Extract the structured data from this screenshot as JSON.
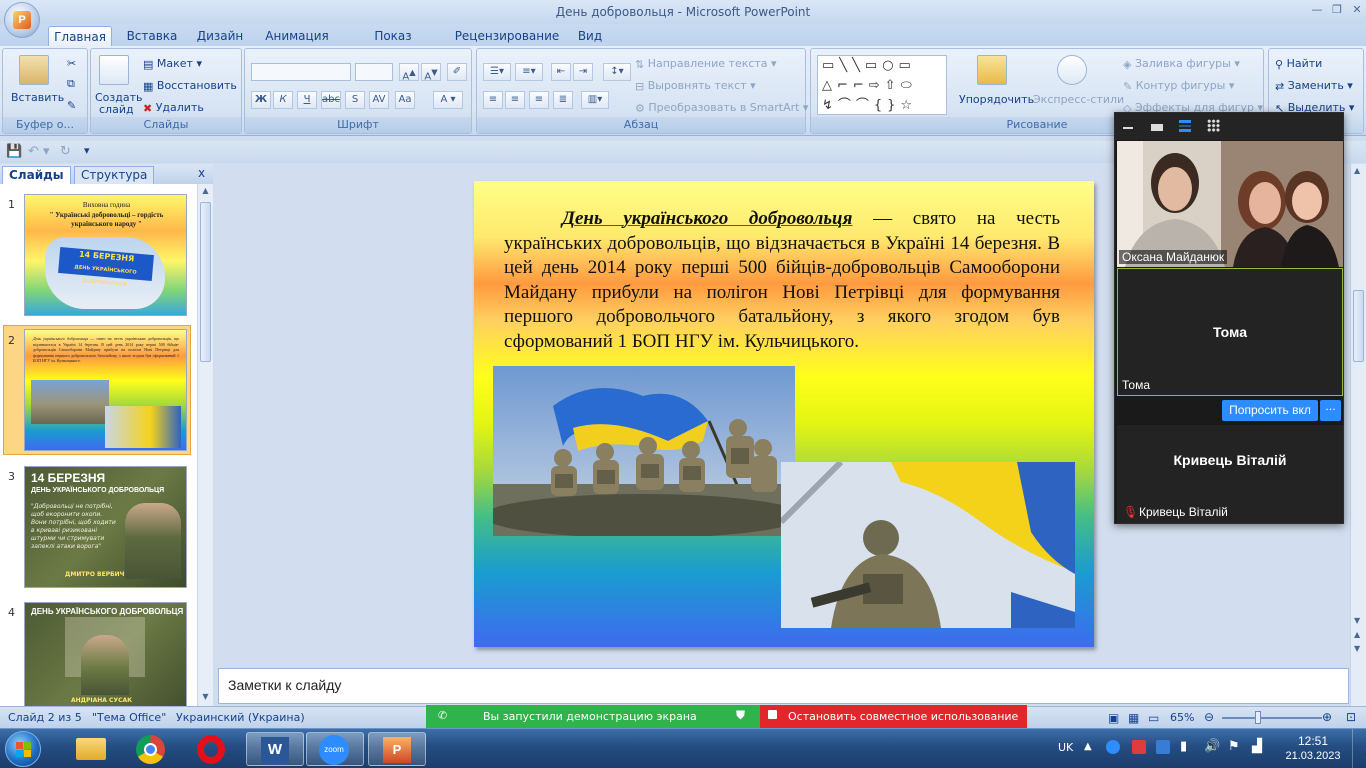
{
  "window": {
    "title": "День добровольця - Microsoft PowerPoint"
  },
  "tabs": [
    "Главная",
    "Вставка",
    "Дизайн",
    "Анимация",
    "Показ слайдов",
    "Рецензирование",
    "Вид"
  ],
  "ribbon": {
    "clipboard": {
      "label": "Буфер о...",
      "paste": "Вставить"
    },
    "slides": {
      "label": "Слайды",
      "create": "Создать",
      "create2": "слайд",
      "layout": "Макет",
      "reset": "Восстановить",
      "delete": "Удалить"
    },
    "font": {
      "label": "Шрифт"
    },
    "paragraph": {
      "label": "Абзац",
      "text_direction": "Направление текста",
      "align_text": "Выровнять текст",
      "smartart": "Преобразовать в SmartArt"
    },
    "drawing": {
      "label": "Рисование",
      "arrange": "Упорядочить",
      "quick_styles": "Экспресс-стили",
      "fill": "Заливка фигуры",
      "outline": "Контур фигуры",
      "effects": "Эффекты для фигур"
    },
    "editing": {
      "find": "Найти",
      "replace": "Заменить",
      "select": "Выделить"
    }
  },
  "left_pane": {
    "tabs": [
      "Слайды",
      "Структура"
    ],
    "slides": [
      {
        "num": "1",
        "title": "Виховна година",
        "subtitle": "\" Українські добровольці – гордість українського народу \"",
        "badge": "14 БЕРЕЗНЯ",
        "badge2": "ДЕНЬ УКРАЇНСЬКОГО ДОБРОВОЛЬЦЯ"
      },
      {
        "num": "2"
      },
      {
        "num": "3",
        "heading": "14 БЕРЕЗНЯ",
        "heading2": "ДЕНЬ УКРАЇНСЬКОГО ДОБРОВОЛЬЦЯ",
        "quote": "\"Добровольці не потрібні, щоб екоронити окопи. Вони потрібні, щоб ходити в криваві ризиковані штурми чи стримувати запеклі атаки ворога\"",
        "name": "ДМИТРО ВЕРБИЧ"
      },
      {
        "num": "4",
        "heading": "ДЕНЬ УКРАЇНСЬКОГО ДОБРОВОЛЬЦЯ",
        "name": "АНДРІАНА СУСАК"
      }
    ]
  },
  "slide": {
    "lead": "День українського добровольця",
    "text": "— свято на честь українських добровольців, що відзначається в Україні 14 березня. В цей день 2014 року перші 500 бійців-добровольців Самооборони Майдану прибули на полігон Нові Петрівці для формування першого добровольчого батальйону, з якого згодом був сформований 1 БОП НГУ ім. Кульчицького."
  },
  "notes": {
    "placeholder": "Заметки к слайду"
  },
  "status": {
    "slide_of": "Слайд 2 из 5",
    "theme": "\"Тема Office\"",
    "language": "Украинский (Украина)",
    "zoom": "65%",
    "zoom_fraction": 0.36
  },
  "share_bar": {
    "started": "Вы запустили демонстрацию экрана",
    "stop": "Остановить совместное использование"
  },
  "zoom": {
    "participants": [
      {
        "name": "Оксана Майданюк"
      },
      {
        "name": "Тома",
        "label": "Тома"
      },
      {
        "name": "Кривець Віталій",
        "label": "Кривець Віталій"
      }
    ],
    "ask_button": "Попросить вкл",
    "more": "···"
  },
  "taskbar": {
    "lang": "UK",
    "time": "12:51",
    "date": "21.03.2023",
    "zoom_app": "zoom"
  },
  "colors": {
    "accent": "#2d8cff",
    "share_green": "#2fb34a",
    "share_red": "#e3262b"
  }
}
